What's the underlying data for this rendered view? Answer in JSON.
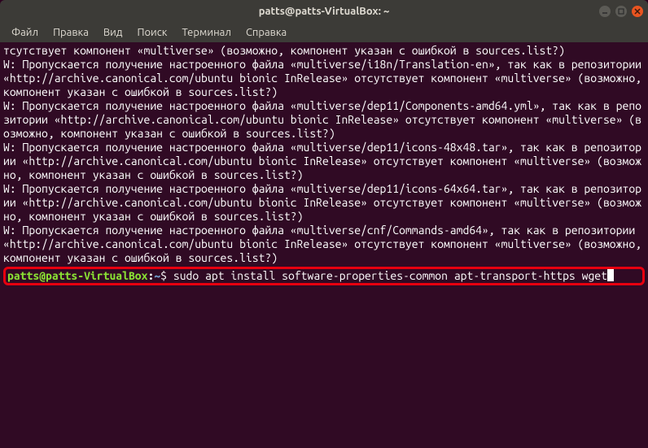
{
  "titlebar": {
    "title": "patts@patts-VirtualBox: ~"
  },
  "menubar": {
    "file": "Файл",
    "edit": "Правка",
    "view": "Вид",
    "search": "Поиск",
    "terminal": "Терминал",
    "help": "Справка"
  },
  "output": {
    "line0": "тсутствует компонент «multiverse» (возможно, компонент указан с ошибкой в sources.list?)",
    "line1": "W: Пропускается получение настроенного файла «multiverse/i18n/Translation-en», так как в репозитории «http://archive.canonical.com/ubuntu bionic InRelease» отсутствует компонент «multiverse» (возможно, компонент указан с ошибкой в sources.list?)",
    "line2": "W: Пропускается получение настроенного файла «multiverse/dep11/Components-amd64.yml», так как в репозитории «http://archive.canonical.com/ubuntu bionic InRelease» отсутствует компонент «multiverse» (возможно, компонент указан с ошибкой в sources.list?)",
    "line3": "W: Пропускается получение настроенного файла «multiverse/dep11/icons-48x48.tar», так как в репозитории «http://archive.canonical.com/ubuntu bionic InRelease» отсутствует компонент «multiverse» (возможно, компонент указан с ошибкой в sources.list?)",
    "line4": "W: Пропускается получение настроенного файла «multiverse/dep11/icons-64x64.tar», так как в репозитории «http://archive.canonical.com/ubuntu bionic InRelease» отсутствует компонент «multiverse» (возможно, компонент указан с ошибкой в sources.list?)",
    "line5": "W: Пропускается получение настроенного файла «multiverse/cnf/Commands-amd64», так как в репозитории «http://archive.canonical.com/ubuntu bionic InRelease» отсутствует компонент «multiverse» (возможно, компонент указан с ошибкой в sources.list?)"
  },
  "prompt": {
    "user_host": "patts@patts-VirtualBox",
    "colon": ":",
    "path": "~",
    "dollar": "$",
    "command": " sudo apt install software-properties-common apt-transport-https wget"
  }
}
